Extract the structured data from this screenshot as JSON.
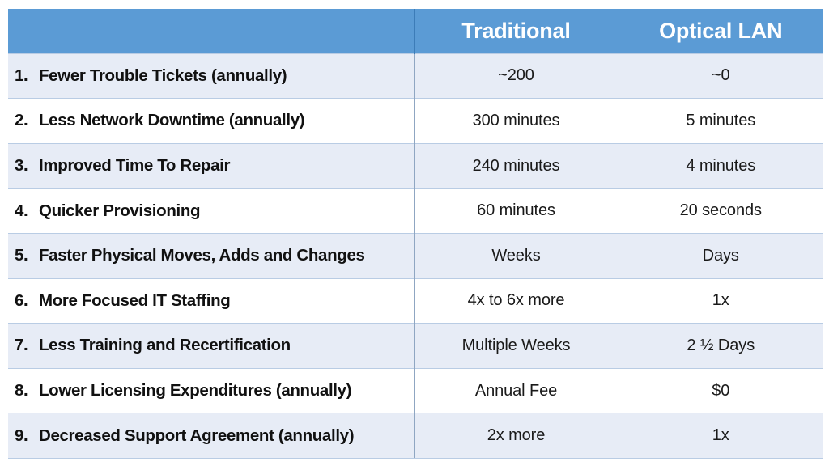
{
  "table": {
    "columns": [
      {
        "key": "benefit",
        "label": "",
        "align": "left"
      },
      {
        "key": "traditional",
        "label": "Traditional",
        "align": "center"
      },
      {
        "key": "optical_lan",
        "label": "Optical LAN",
        "align": "center"
      }
    ],
    "header": {
      "blank": "",
      "traditional": "Traditional",
      "optical_lan": "Optical LAN"
    },
    "rows": [
      {
        "num": "1.",
        "label": "Fewer Trouble Tickets (annually)",
        "traditional": "~200",
        "optical_lan": "~0"
      },
      {
        "num": "2.",
        "label": "Less Network Downtime (annually)",
        "traditional": "300 minutes",
        "optical_lan": "5 minutes"
      },
      {
        "num": "3.",
        "label": "Improved Time To Repair",
        "traditional": "240 minutes",
        "optical_lan": "4 minutes"
      },
      {
        "num": "4.",
        "label": "Quicker Provisioning",
        "traditional": "60 minutes",
        "optical_lan": "20 seconds"
      },
      {
        "num": "5.",
        "label": "Faster Physical Moves, Adds and Changes",
        "traditional": "Weeks",
        "optical_lan": "Days"
      },
      {
        "num": "6.",
        "label": "More Focused IT Staffing",
        "traditional": "4x to 6x more",
        "optical_lan": "1x"
      },
      {
        "num": "7.",
        "label": "Less Training and Recertification",
        "traditional": "Multiple Weeks",
        "optical_lan": "2 ½ Days"
      },
      {
        "num": "8.",
        "label": "Lower Licensing Expenditures (annually)",
        "traditional": "Annual Fee",
        "optical_lan": "$0"
      },
      {
        "num": "9.",
        "label": "Decreased Support Agreement (annually)",
        "traditional": "2x more",
        "optical_lan": "1x"
      }
    ]
  },
  "colors": {
    "header_background": "#5B9BD5",
    "header_text": "#FFFFFF",
    "row_alt_background": "#E7ECF6",
    "row_plain_background": "#FFFFFF",
    "row_border": "#B9CCE4",
    "column_divider": "#8FA6C2",
    "body_text": "#111111",
    "page_background": "#FFFFFF"
  }
}
